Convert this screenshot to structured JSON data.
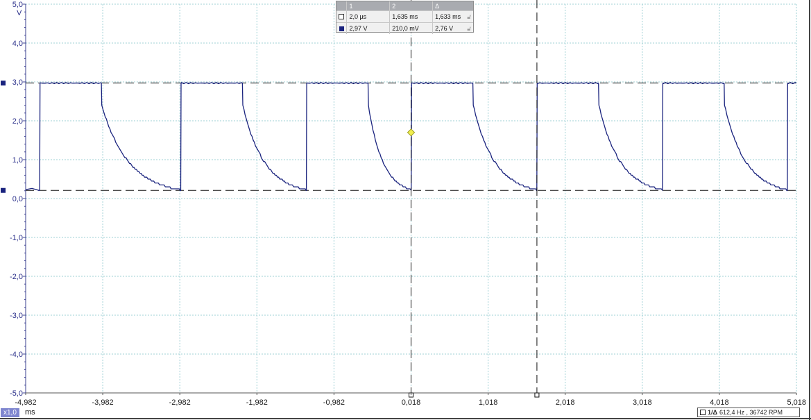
{
  "chart_data": {
    "type": "line",
    "y_unit": "V",
    "x_unit": "ms",
    "xlim": [
      -4.982,
      5.018
    ],
    "ylim": [
      -5.0,
      5.0
    ],
    "x_ticks": [
      "-4,982",
      "-3,982",
      "-2,982",
      "-1,982",
      "-0,982",
      "0,018",
      "1,018",
      "2,018",
      "3,018",
      "4,018",
      "5,018"
    ],
    "y_ticks": [
      "5,0",
      "4,0",
      "3,0",
      "2,0",
      "1,0",
      "0,0",
      "-1,0",
      "-2,0",
      "-3,0",
      "-4,0",
      "-5,0"
    ],
    "grid": true,
    "waveform": {
      "period_ms": 1.633,
      "rise_times_ms": [
        -4.8,
        -2.97,
        -1.34,
        0.02,
        1.65,
        3.28,
        4.9
      ],
      "high_V": 2.97,
      "low_V": 0.21,
      "plateau_ms": 0.8,
      "drop_to_V": 2.4
    },
    "cursors": {
      "vertical_ms": [
        0.018,
        1.651
      ],
      "horizontal_V": [
        2.97,
        0.21
      ]
    },
    "trigger": {
      "x_ms": 0.018,
      "y_V": 1.7
    }
  },
  "cursor_table": {
    "headers": [
      "1",
      "2",
      "Δ"
    ],
    "rows": [
      {
        "v1": "2,0 µs",
        "v2": "1,635 ms",
        "delta": "1,633 ms"
      },
      {
        "v1": "2,97 V",
        "v2": "210,0 mV",
        "delta": "2,76 V"
      }
    ]
  },
  "toolbar": {
    "zoom": "x1,0"
  },
  "status": {
    "freq": "612,4 Hz , 36742 RPM",
    "channel_label": "1/Δ"
  },
  "colors": {
    "trace": "#1a237e",
    "grid": "#9fd0d5",
    "cursor": "#111111",
    "trigger": "#f1ee4f"
  }
}
